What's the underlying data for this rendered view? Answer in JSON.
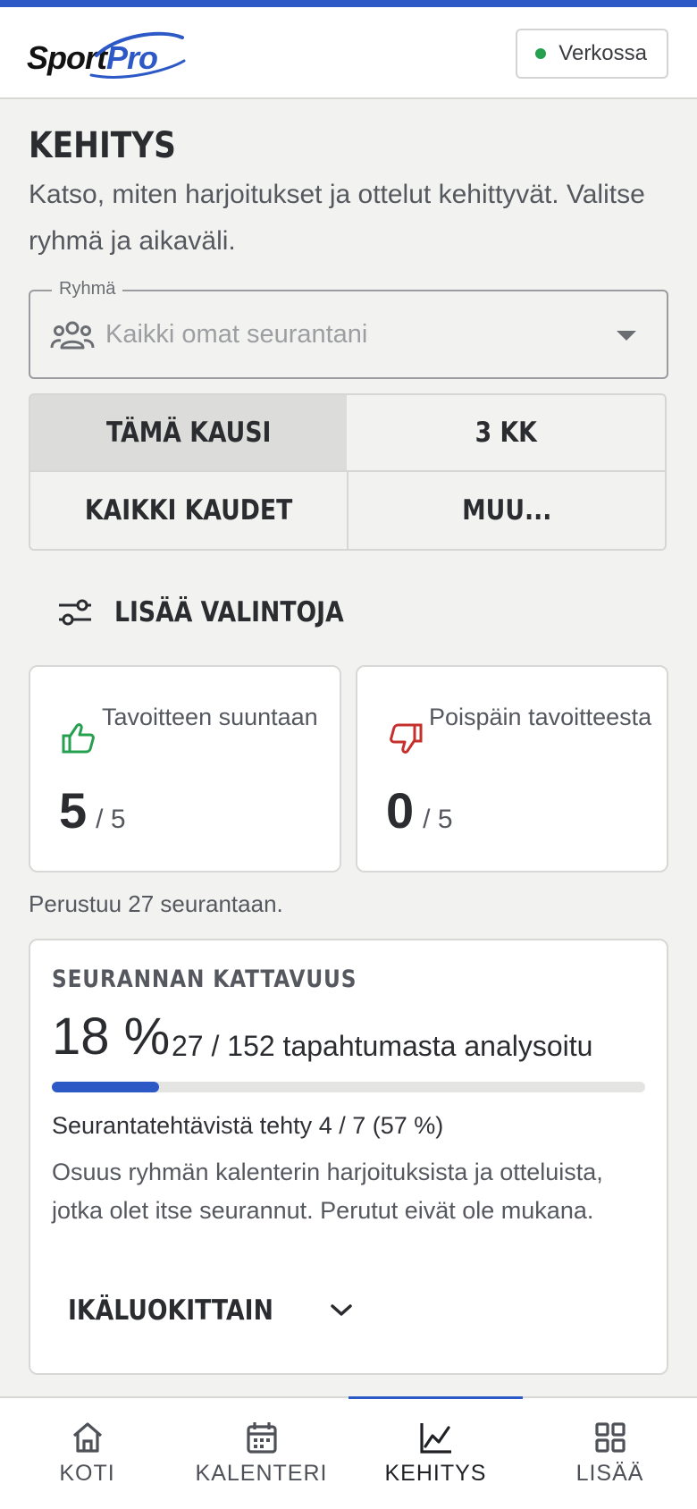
{
  "app": {
    "logo_part1": "Sport",
    "logo_part2": "Pro",
    "status": "Verkossa"
  },
  "page": {
    "title": "KEHITYS",
    "description": "Katso, miten harjoitukset ja ottelut kehittyvät. Valitse ryhmä ja aikaväli."
  },
  "group_select": {
    "label": "Ryhmä",
    "value": "Kaikki omat seurantani"
  },
  "periods": [
    {
      "label": "TÄMÄ KAUSI",
      "selected": true
    },
    {
      "label": "3 KK",
      "selected": false
    },
    {
      "label": "KAIKKI KAUDET",
      "selected": false
    },
    {
      "label": "MUU...",
      "selected": false
    }
  ],
  "more_options": "LISÄÄ VALINTOJA",
  "stats": {
    "toward": {
      "label": "Tavoitteen suuntaan",
      "value": "5",
      "total": "/ 5"
    },
    "away": {
      "label": "Poispäin tavoitteesta",
      "value": "0",
      "total": "/ 5"
    }
  },
  "based_on": "Perustuu 27 seurantaan.",
  "coverage": {
    "title": "SEURANNAN KATTAVUUS",
    "percent_text": "18 %",
    "percent": 18,
    "count_text": "27 / 152 tapahtumasta analysoitu",
    "tasks_text": "Seurantatehtävistä tehty 4 / 7 (57 %)",
    "description": "Osuus ryhmän kalenterin harjoituksista ja otteluista, jotka olet itse seurannut. Perutut eivät ole mukana.",
    "expand_label": "IKÄLUOKITTAIN"
  },
  "nav": [
    {
      "label": "KOTI",
      "icon": "home-icon",
      "active": false
    },
    {
      "label": "KALENTERI",
      "icon": "calendar-icon",
      "active": false
    },
    {
      "label": "KEHITYS",
      "icon": "chart-icon",
      "active": true
    },
    {
      "label": "LISÄÄ",
      "icon": "grid-icon",
      "active": false
    }
  ],
  "colors": {
    "accent": "#2c59c6",
    "positive": "#25a04f",
    "negative": "#c6302c"
  }
}
